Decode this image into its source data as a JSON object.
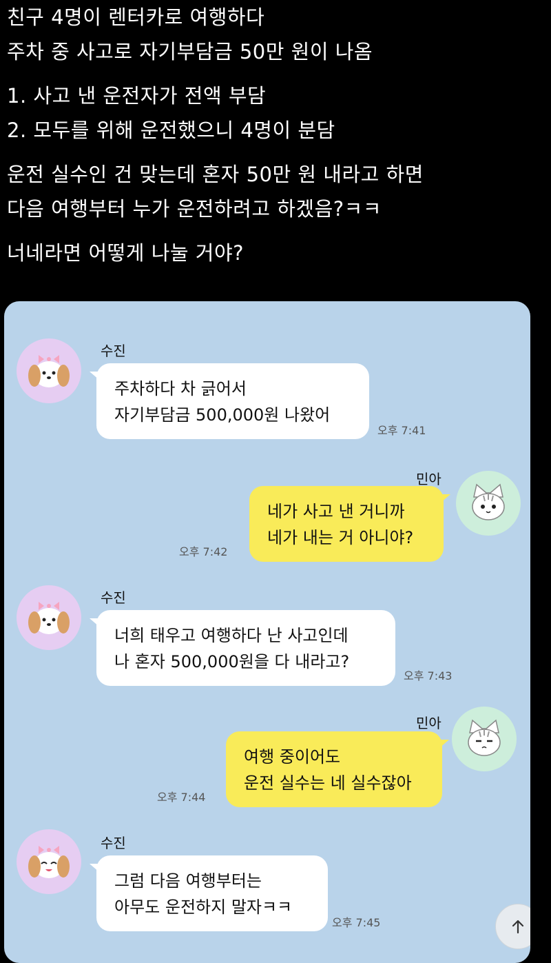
{
  "intro": {
    "lines": [
      "친구 4명이 렌터카로 여행하다",
      "주차 중 사고로 자기부담금 50만 원이 나옴",
      "1. 사고 낸 운전자가 전액 부담",
      "2. 모두를 위해 운전했으니 4명이 분담",
      "운전 실수인 건 맞는데 혼자 50만 원 내라고 하면",
      "다음 여행부터 누가 운전하려고 하겠음?ㅋㅋ",
      "너네라면 어떻게 나눌 거야?"
    ]
  },
  "chat": {
    "messages": [
      {
        "sender": "수진",
        "lines": [
          "주차하다 차 긁어서",
          "자기부담금 500,000원 나왔어"
        ],
        "time": "오후 7:41"
      },
      {
        "sender": "민아",
        "lines": [
          "네가 사고 낸 거니까",
          "네가 내는 거 아니야?"
        ],
        "time": "오후 7:42"
      },
      {
        "sender": "수진",
        "lines": [
          "너희 태우고 여행하다 난 사고인데",
          "나 혼자 500,000원을 다 내라고?"
        ],
        "time": "오후 7:43"
      },
      {
        "sender": "민아",
        "lines": [
          "여행 중이어도",
          "운전 실수는 네 실수잖아"
        ],
        "time": "오후 7:44"
      },
      {
        "sender": "수진",
        "lines": [
          "그럼 다음 여행부터는",
          "아무도 운전하지 말자ㅋㅋ"
        ],
        "time": "오후 7:45"
      }
    ]
  },
  "colors": {
    "chat_bg": "#b9d3ea",
    "incoming_bubble": "#ffffff",
    "outgoing_bubble": "#f9eb59",
    "dog_avatar_bg": "#e6cdf2",
    "cat_avatar_bg": "#cdeedb"
  },
  "icons": {
    "dog_avatar": "puppy-avatar-icon",
    "cat_avatar": "kitten-avatar-icon",
    "scroll_top": "arrow-up-icon"
  }
}
